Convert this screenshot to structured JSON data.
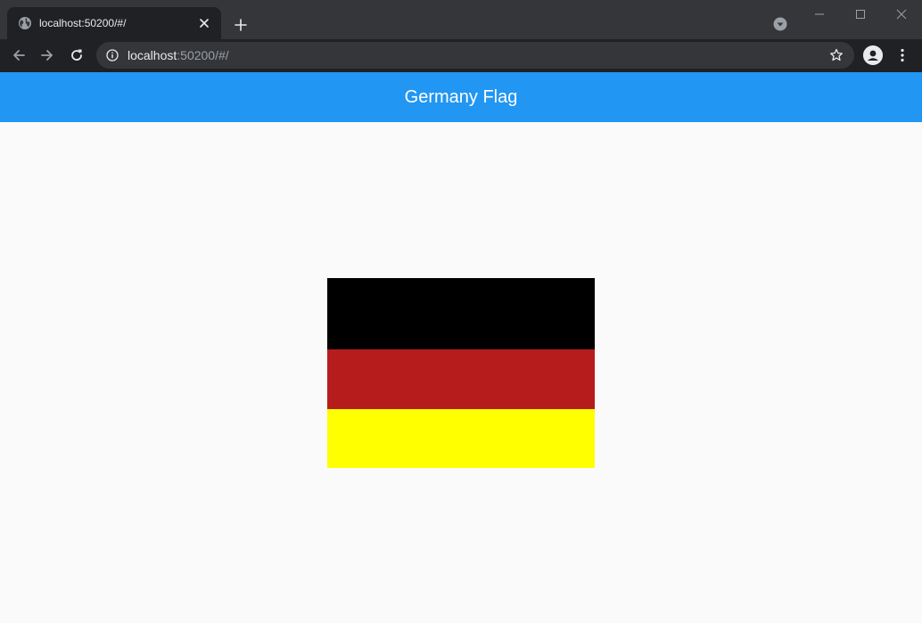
{
  "browser": {
    "tab": {
      "title": "localhost:50200/#/",
      "favicon": "globe-icon"
    },
    "new_tab_icon": "plus-icon",
    "tab_search_icon": "chevron-down-circle-icon",
    "window_controls": [
      "minimize-icon",
      "maximize-icon",
      "close-icon"
    ],
    "nav": {
      "back_icon": "arrow-left-icon",
      "forward_icon": "arrow-right-icon",
      "reload_icon": "reload-icon"
    },
    "address_bar": {
      "host": "localhost",
      "rest": ":50200/#/",
      "info_icon": "info-icon",
      "bookmark_icon": "star-icon"
    },
    "profile_icon": "person-icon",
    "menu_icon": "kebab-menu-icon"
  },
  "app": {
    "title": "Germany Flag",
    "appbar_color": "#2196f3",
    "background_color": "#fafafa"
  },
  "flag": {
    "stripes": [
      {
        "name": "black",
        "color": "#000000"
      },
      {
        "name": "red",
        "color": "#b71c1c"
      },
      {
        "name": "yellow",
        "color": "#ffff00"
      }
    ]
  }
}
